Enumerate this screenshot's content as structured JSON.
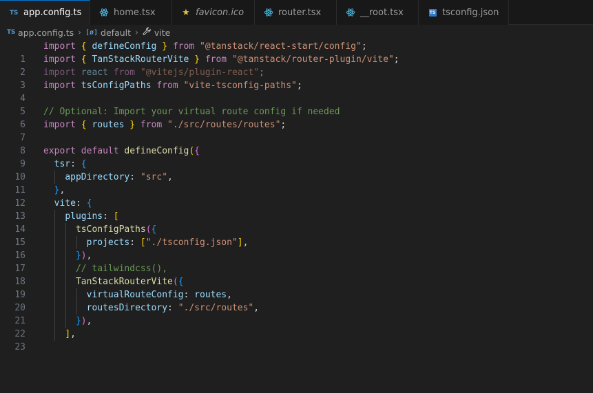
{
  "tabs": [
    {
      "label": "app.config.ts",
      "icon": "typescript-icon",
      "active": true,
      "close": "✕"
    },
    {
      "label": "home.tsx",
      "icon": "react-icon",
      "active": false
    },
    {
      "label": "favicon.ico",
      "icon": "star-icon",
      "active": false
    },
    {
      "label": "router.tsx",
      "icon": "react-icon",
      "active": false
    },
    {
      "label": "__root.tsx",
      "icon": "react-icon",
      "active": false
    },
    {
      "label": "tsconfig.json",
      "icon": "tsconfig-icon",
      "active": false
    }
  ],
  "breadcrumb": {
    "file": "app.config.ts",
    "symbol": "default",
    "property": "vite",
    "file_badge": "TS",
    "symbol_badge": "[ø]"
  },
  "line_numbers": [
    "1",
    "2",
    "3",
    "4",
    "5",
    "6",
    "7",
    "8",
    "9",
    "10",
    "11",
    "12",
    "13",
    "14",
    "15",
    "16",
    "17",
    "18",
    "19",
    "20",
    "21",
    "22",
    "23"
  ],
  "code": {
    "l1": [
      "import",
      "{",
      "defineConfig",
      "}",
      "from",
      "\"@tanstack/react-start/config\"",
      ";"
    ],
    "l2": [
      "import",
      "{",
      "TanStackRouterVite",
      "}",
      "from",
      "\"@tanstack/router-plugin/vite\"",
      ";"
    ],
    "l3": [
      "import",
      "react",
      "from",
      "\"@vitejs/plugin-react\"",
      ";"
    ],
    "l4": [
      "import",
      "tsConfigPaths",
      "from",
      "\"vite-tsconfig-paths\"",
      ";"
    ],
    "l6": [
      "// Optional: Import your virtual route config if needed"
    ],
    "l7": [
      "import",
      "{",
      "routes",
      "}",
      "from",
      "\"./src/routes/routes\"",
      ";"
    ],
    "l9": [
      "export",
      "default",
      "defineConfig",
      "(",
      "{"
    ],
    "l10": [
      "tsr",
      ":",
      "{"
    ],
    "l11": [
      "appDirectory",
      ":",
      "\"src\"",
      ","
    ],
    "l12": [
      "}",
      ","
    ],
    "l13": [
      "vite",
      ":",
      "{"
    ],
    "l14": [
      "plugins",
      ":",
      "["
    ],
    "l15": [
      "tsConfigPaths",
      "(",
      "{"
    ],
    "l16": [
      "projects",
      ":",
      "[",
      "\"./tsconfig.json\"",
      "]",
      ","
    ],
    "l17": [
      "}",
      ")",
      ","
    ],
    "l18": [
      "// tailwindcss(),"
    ],
    "l19": [
      "TanStackRouterVite",
      "(",
      "{"
    ],
    "l20": [
      "virtualRouteConfig",
      ":",
      "routes",
      ","
    ],
    "l21": [
      "routesDirectory",
      ":",
      "\"./src/routes\"",
      ","
    ],
    "l22": [
      "}",
      ")",
      ","
    ],
    "l23": [
      "]",
      ","
    ]
  },
  "colors": {
    "keyword": "#c586c0",
    "keyword_blue": "#569cd6",
    "function": "#dcdcaa",
    "variable": "#9cdcfe",
    "string": "#ce9178",
    "comment": "#6a9955",
    "active_tab_border": "#0078d4"
  }
}
